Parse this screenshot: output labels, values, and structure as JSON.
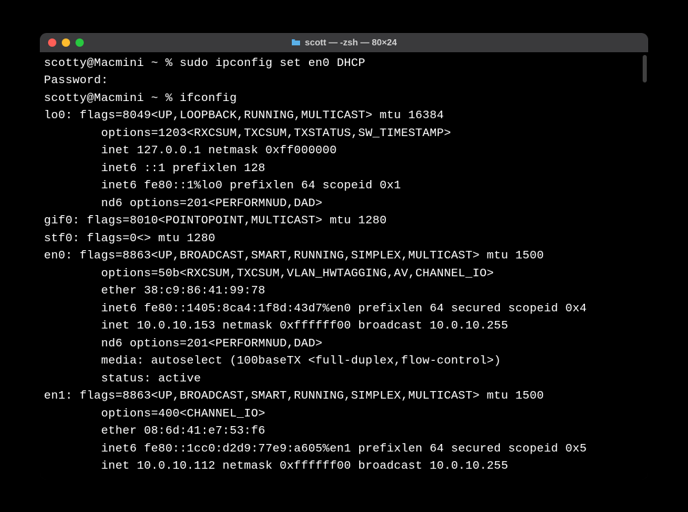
{
  "window": {
    "title": "scott — -zsh — 80×24"
  },
  "terminal": {
    "lines": [
      "scotty@Macmini ~ % sudo ipconfig set en0 DHCP",
      "Password:",
      "scotty@Macmini ~ % ifconfig",
      "lo0: flags=8049<UP,LOOPBACK,RUNNING,MULTICAST> mtu 16384",
      "        options=1203<RXCSUM,TXCSUM,TXSTATUS,SW_TIMESTAMP>",
      "        inet 127.0.0.1 netmask 0xff000000",
      "        inet6 ::1 prefixlen 128",
      "        inet6 fe80::1%lo0 prefixlen 64 scopeid 0x1",
      "        nd6 options=201<PERFORMNUD,DAD>",
      "gif0: flags=8010<POINTOPOINT,MULTICAST> mtu 1280",
      "stf0: flags=0<> mtu 1280",
      "en0: flags=8863<UP,BROADCAST,SMART,RUNNING,SIMPLEX,MULTICAST> mtu 1500",
      "        options=50b<RXCSUM,TXCSUM,VLAN_HWTAGGING,AV,CHANNEL_IO>",
      "        ether 38:c9:86:41:99:78",
      "        inet6 fe80::1405:8ca4:1f8d:43d7%en0 prefixlen 64 secured scopeid 0x4",
      "        inet 10.0.10.153 netmask 0xffffff00 broadcast 10.0.10.255",
      "        nd6 options=201<PERFORMNUD,DAD>",
      "        media: autoselect (100baseTX <full-duplex,flow-control>)",
      "        status: active",
      "en1: flags=8863<UP,BROADCAST,SMART,RUNNING,SIMPLEX,MULTICAST> mtu 1500",
      "        options=400<CHANNEL_IO>",
      "        ether 08:6d:41:e7:53:f6",
      "        inet6 fe80::1cc0:d2d9:77e9:a605%en1 prefixlen 64 secured scopeid 0x5",
      "        inet 10.0.10.112 netmask 0xffffff00 broadcast 10.0.10.255"
    ]
  }
}
